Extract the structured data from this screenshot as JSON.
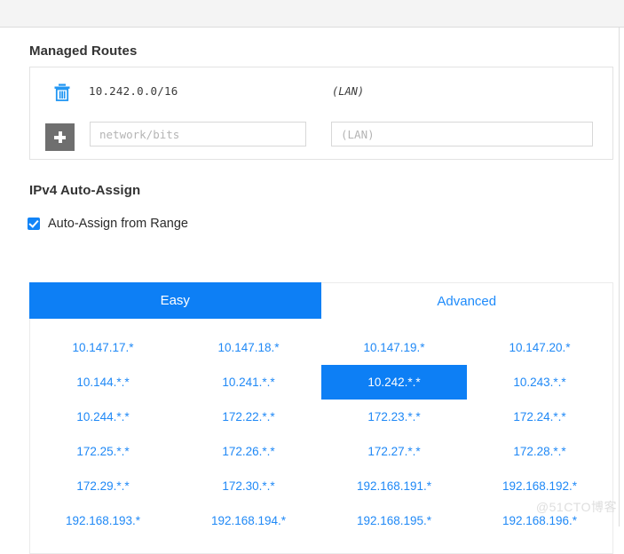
{
  "window": {
    "topbar_present": true
  },
  "sections": {
    "managed_routes": {
      "title": "Managed Routes",
      "existing_route": {
        "delete_icon": "trash-icon",
        "network": "10.242.0.0/16",
        "via_label": "(LAN)"
      },
      "add_row": {
        "add_icon": "plus-icon",
        "network_placeholder": "network/bits",
        "network_value": "",
        "via_placeholder": "(LAN)",
        "via_value": ""
      }
    },
    "ipv4_auto_assign": {
      "title": "IPv4 Auto-Assign",
      "checkbox": {
        "label": "Auto-Assign from Range",
        "checked": true
      },
      "tabs": [
        {
          "label": "Easy",
          "active": true
        },
        {
          "label": "Advanced",
          "active": false
        }
      ],
      "ranges": [
        {
          "label": "10.147.17.*",
          "selected": false
        },
        {
          "label": "10.147.18.*",
          "selected": false
        },
        {
          "label": "10.147.19.*",
          "selected": false
        },
        {
          "label": "10.147.20.*",
          "selected": false
        },
        {
          "label": "10.144.*.*",
          "selected": false
        },
        {
          "label": "10.241.*.*",
          "selected": false
        },
        {
          "label": "10.242.*.*",
          "selected": true
        },
        {
          "label": "10.243.*.*",
          "selected": false
        },
        {
          "label": "10.244.*.*",
          "selected": false
        },
        {
          "label": "172.22.*.*",
          "selected": false
        },
        {
          "label": "172.23.*.*",
          "selected": false
        },
        {
          "label": "172.24.*.*",
          "selected": false
        },
        {
          "label": "172.25.*.*",
          "selected": false
        },
        {
          "label": "172.26.*.*",
          "selected": false
        },
        {
          "label": "172.27.*.*",
          "selected": false
        },
        {
          "label": "172.28.*.*",
          "selected": false
        },
        {
          "label": "172.29.*.*",
          "selected": false
        },
        {
          "label": "172.30.*.*",
          "selected": false
        },
        {
          "label": "192.168.191.*",
          "selected": false
        },
        {
          "label": "192.168.192.*",
          "selected": false
        },
        {
          "label": "192.168.193.*",
          "selected": false
        },
        {
          "label": "192.168.194.*",
          "selected": false
        },
        {
          "label": "192.168.195.*",
          "selected": false
        },
        {
          "label": "192.168.196.*",
          "selected": false
        }
      ]
    }
  },
  "watermark": "@51CTO博客",
  "colors": {
    "accent_blue": "#0d7ff5",
    "link_blue": "#2089f6",
    "add_button_gray": "#6f6f6f",
    "topbar_gray": "#f4f4f4",
    "border_gray": "#e3e3e3"
  }
}
